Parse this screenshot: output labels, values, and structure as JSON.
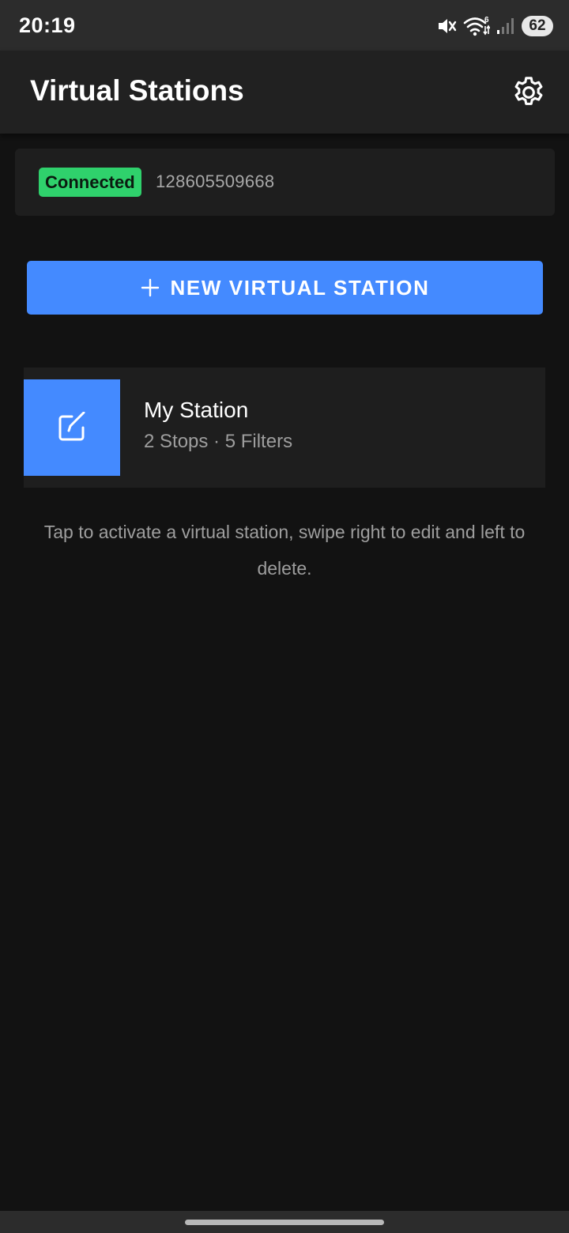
{
  "status_bar": {
    "time": "20:19",
    "battery": "62",
    "icons": [
      "mute-icon",
      "wifi-icon",
      "signal-icon",
      "battery-icon"
    ]
  },
  "app_bar": {
    "title": "Virtual Stations",
    "settings_icon": "gear-icon"
  },
  "connection": {
    "status": "Connected",
    "id": "128605509668",
    "status_color": "#2fd16c"
  },
  "new_station_button": {
    "label": "NEW VIRTUAL STATION",
    "icon": "plus-icon",
    "color": "#448aff"
  },
  "stations": [
    {
      "name": "My Station",
      "meta": "2 Stops · 5 Filters",
      "swipe_action_icon": "edit-icon"
    }
  ],
  "hint": "Tap to activate a virtual station, swipe right to edit and left to delete.",
  "colors": {
    "background": "#121212",
    "surface": "#1e1e1e",
    "app_bar": "#212121",
    "accent": "#448aff"
  }
}
